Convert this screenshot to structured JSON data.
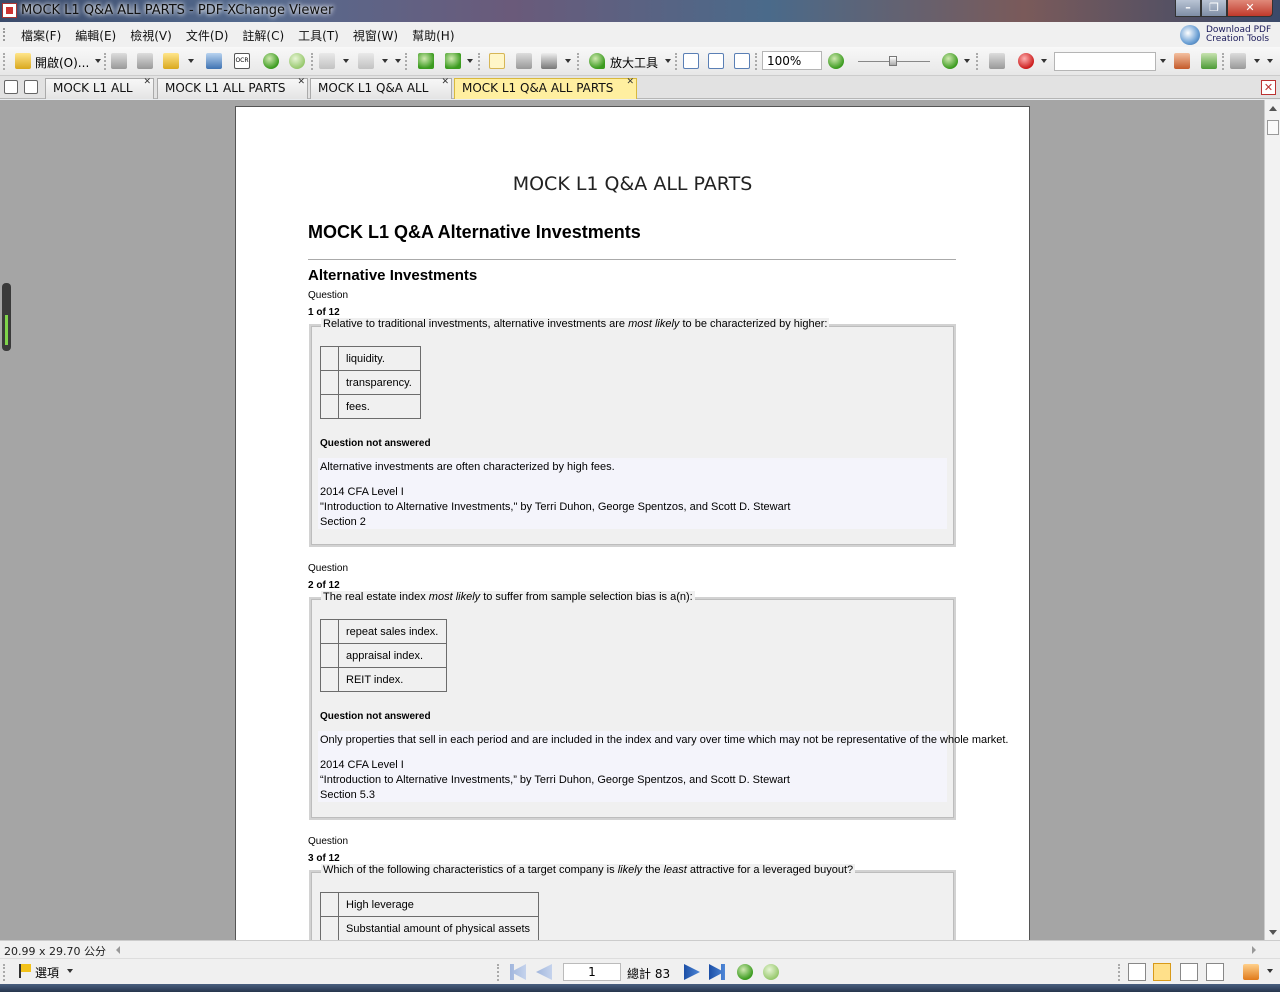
{
  "window": {
    "title": "MOCK L1 Q&A ALL PARTS - PDF-XChange Viewer",
    "minimize": "–",
    "restore": "❐",
    "close": "✕"
  },
  "menu": [
    "檔案(F)",
    "編輯(E)",
    "檢視(V)",
    "文件(D)",
    "註解(C)",
    "工具(T)",
    "視窗(W)",
    "幫助(H)"
  ],
  "download_tools": "Download PDF Creation Tools",
  "toolbar": {
    "open_label": "開啟(O)...",
    "zoom_tool_label": "放大工具",
    "zoom_value": "100%",
    "search_value": ""
  },
  "tabs": [
    {
      "label": "MOCK L1 ALL",
      "active": false
    },
    {
      "label": "MOCK L1 ALL PARTS",
      "active": false
    },
    {
      "label": "MOCK L1 Q&A ALL",
      "active": false
    },
    {
      "label": "MOCK L1 Q&A ALL PARTS",
      "active": true
    }
  ],
  "tab_close_glyph": "✕",
  "document": {
    "title": "MOCK L1 Q&A ALL PARTS",
    "section_heading": "MOCK L1 Q&A Alternative Investments",
    "subsection_heading": "Alternative Investments",
    "question_label": "Question",
    "questions": [
      {
        "number": "1 of 12",
        "text_before": "Relative to traditional investments, alternative investments are ",
        "text_em": "most likely",
        "text_after": " to be characterized by higher:",
        "options": [
          "liquidity.",
          "transparency.",
          "fees."
        ],
        "status": "Question not answered",
        "explanation": "Alternative investments are often characterized by high fees.",
        "source_lines": [
          "2014 CFA Level I",
          "\"Introduction to Alternative Investments,\" by Terri Duhon, George Spentzos, and Scott D. Stewart",
          "Section 2"
        ]
      },
      {
        "number": "2 of 12",
        "text_before": "The real estate index ",
        "text_em": "most likely",
        "text_after": " to suffer from sample selection bias is a(n):",
        "options": [
          "repeat sales index.",
          "appraisal index.",
          "REIT index."
        ],
        "status": "Question not answered",
        "explanation": "Only properties that sell in each period and are included in the index and vary over time which may not be representative of the whole market.",
        "source_lines": [
          "2014 CFA Level I",
          "“Introduction to Alternative Investments,” by Terri Duhon, George Spentzos, and Scott D. Stewart",
          "Section 5.3"
        ]
      },
      {
        "number": "3 of 12",
        "text_before": "Which of the following characteristics of a target company is ",
        "text_em": "likely",
        "text_mid": " the ",
        "text_em2": "least",
        "text_after": " attractive for a leveraged buyout?",
        "options": [
          "High leverage",
          "Substantial amount of physical assets"
        ]
      }
    ]
  },
  "status_bar": {
    "page_size": "20.99 x 29.70 公分"
  },
  "nav_bar": {
    "options_label": "選項",
    "current_page": "1",
    "total_pages": "總計 83"
  }
}
